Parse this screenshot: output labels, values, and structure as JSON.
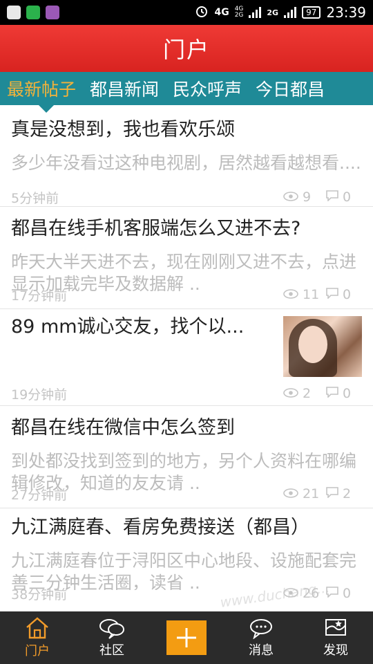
{
  "status_bar": {
    "network": "4G",
    "network_small_top": "4G",
    "network_small_bottom": "2G",
    "network_2": "2G",
    "battery": "97",
    "time": "23:39"
  },
  "header": {
    "title": "门户"
  },
  "tabs": [
    {
      "label": "最新帖子",
      "active": true
    },
    {
      "label": "都昌新闻",
      "active": false
    },
    {
      "label": "民众呼声",
      "active": false
    },
    {
      "label": "今日都昌",
      "active": false
    }
  ],
  "posts": [
    {
      "title": "真是没想到，我也看欢乐颂",
      "excerpt": "多少年没看过这种电视剧，居然越看越想看....",
      "time": "5分钟前",
      "views": "9",
      "comments": "0"
    },
    {
      "title": "都昌在线手机客服端怎么又进不去?",
      "excerpt": "昨天大半天进不去，现在刚刚又进不去，点进显示加载完毕及数据解 ..",
      "time": "17分钟前",
      "views": "11",
      "comments": "0"
    },
    {
      "title": "89 mm诚心交友，找个以...",
      "excerpt": "",
      "time": "19分钟前",
      "views": "2",
      "comments": "0",
      "has_thumbnail": true
    },
    {
      "title": "都昌在线在微信中怎么签到",
      "excerpt": "到处都没找到签到的地方，另个人资料在哪编辑修改，知道的友友请 ..",
      "time": "27分钟前",
      "views": "21",
      "comments": "2"
    },
    {
      "title": "九江满庭春、看房免费接送（都昌）",
      "excerpt": "九江满庭春位于浔阳区中心地段、设施配套完善三分钟生活圈，读省 ..",
      "time": "38分钟前",
      "views": "26",
      "comments": "0"
    }
  ],
  "bottom_nav": [
    {
      "label": "门户",
      "icon": "home-icon",
      "active": true
    },
    {
      "label": "社区",
      "icon": "chat-bubbles-icon",
      "active": false
    },
    {
      "label": "",
      "icon": "plus-icon",
      "active": false
    },
    {
      "label": "消息",
      "icon": "message-icon",
      "active": false
    },
    {
      "label": "发现",
      "icon": "discover-flag-icon",
      "active": false
    }
  ],
  "watermark": "www.duchang...",
  "colors": {
    "header_red": "#e0302c",
    "tab_teal": "#1f8a97",
    "tab_active": "#f3b23a",
    "nav_bg": "#2b2b2b",
    "nav_active": "#f39c2a",
    "plus_orange": "#f39c12"
  }
}
